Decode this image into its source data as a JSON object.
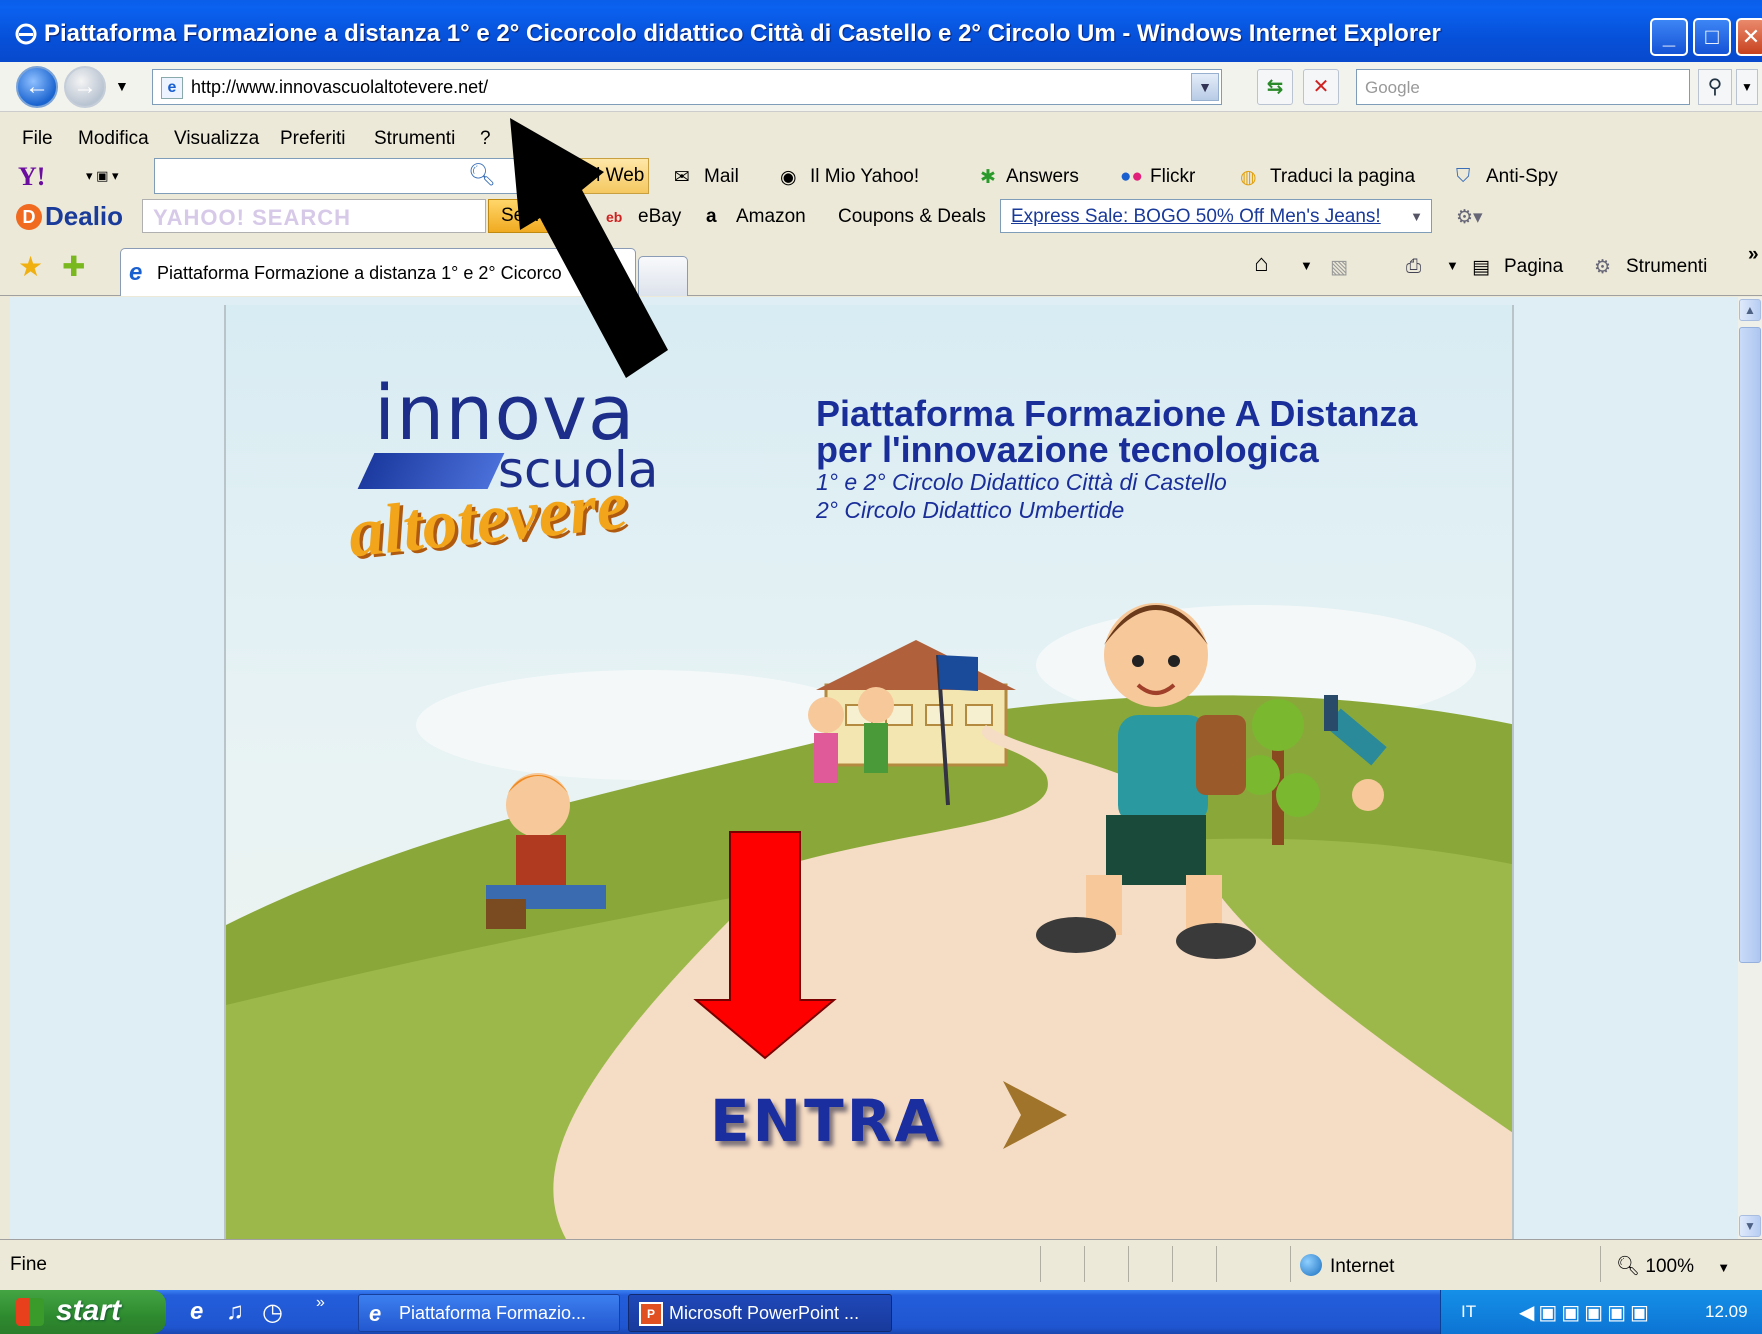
{
  "window": {
    "title": "Piattaforma Formazione a distanza 1° e 2° Cicorcolo didattico Città di Castello e 2° Circolo Um - Windows Internet Explorer"
  },
  "address_bar": {
    "url": "http://www.innovascuolaltotevere.net/",
    "search_placeholder": "Google"
  },
  "menu": [
    "File",
    "Modifica",
    "Visualizza",
    "Preferiti",
    "Strumenti",
    "?"
  ],
  "yahoo_toolbar": {
    "web_button": "nel Web",
    "items": [
      "Mail",
      "Il Mio Yahoo!",
      "Answers",
      "Flickr",
      "Traduci la pagina",
      "Anti-Spy"
    ]
  },
  "dealio_toolbar": {
    "logo": "Dealio",
    "search_placeholder": "YAHOO! SEARCH",
    "search_button": "Search",
    "items": [
      "eBay",
      "Amazon",
      "Coupons & Deals"
    ],
    "deal_link": "Express Sale: BOGO 50% Off Men's Jeans!"
  },
  "tabs": {
    "active_tab": "Piattaforma Formazione a distanza 1° e 2° Cicorco",
    "command_items": [
      "Pagina",
      "Strumenti"
    ]
  },
  "page": {
    "logo_innova": "innova",
    "logo_scuola": "scuola",
    "logo_altotevere": "altotevere",
    "headline_line1": "Piattaforma Formazione A Distanza",
    "headline_line2": "per l'innovazione tecnologica",
    "sub_line1": "1° e 2° Circolo Didattico Città di Castello",
    "sub_line2": "2° Circolo Didattico Umbertide",
    "enter_button": "ENTRA"
  },
  "status_bar": {
    "status": "Fine",
    "zone": "Internet",
    "zoom": "100%"
  },
  "taskbar": {
    "start": "start",
    "items": [
      "Piattaforma Formazio...",
      "Microsoft PowerPoint ..."
    ],
    "language": "IT",
    "clock": "12.09"
  },
  "colors": {
    "title_blue": "#0650d8",
    "headline_blue": "#1a2e9a",
    "grass": "#8aa83a",
    "path": "#f5dcc4",
    "annotation_black_arrow": "#000000",
    "annotation_red_arrow": "#ff0000"
  }
}
